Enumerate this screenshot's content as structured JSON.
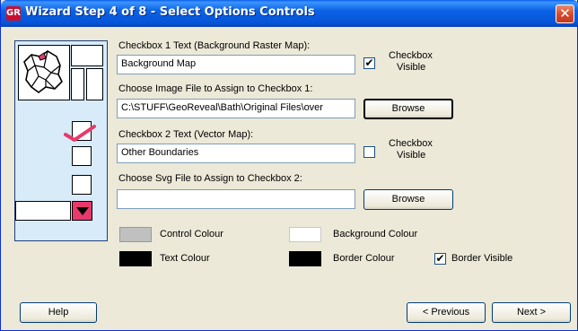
{
  "window": {
    "title": "Wizard Step 4 of 8 - Select Options Controls",
    "icon": "GR",
    "close_glyph": "✕"
  },
  "fields": {
    "cb1_text_label": "Checkbox 1 Text (Background Raster Map):",
    "cb1_text_value": "Background Map",
    "cb1_visible_label_1": "Checkbox",
    "cb1_visible_label_2": "Visible",
    "cb1_visible_checked": true,
    "cb1_file_label": "Choose Image File to Assign to Checkbox 1:",
    "cb1_file_value": "C:\\STUFF\\GeoReveal\\Bath\\Original Files\\over",
    "cb2_text_label": "Checkbox 2 Text (Vector Map):",
    "cb2_text_value": "Other Boundaries",
    "cb2_visible_label_1": "Checkbox",
    "cb2_visible_label_2": "Visible",
    "cb2_visible_checked": false,
    "cb2_file_label": "Choose Svg File to Assign to Checkbox 2:",
    "cb2_file_value": ""
  },
  "buttons": {
    "browse1": "Browse",
    "browse2": "Browse",
    "help": "Help",
    "previous": "< Previous",
    "next": "Next >"
  },
  "colours": {
    "control_label": "Control Colour",
    "control_value": "#c0c0c0",
    "background_label": "Background Colour",
    "background_value": "#ffffff",
    "text_label": "Text Colour",
    "text_value": "#000000",
    "border_label": "Border Colour",
    "border_value": "#000000",
    "border_visible_label": "Border Visible",
    "border_visible_checked": true
  },
  "check_glyph": "✔",
  "theme": {
    "titlebar": "#0b62e4",
    "preview_bg": "#d8ebf8",
    "preview_check": "#e8396b",
    "dropdown_arrow": "#e8396b"
  }
}
